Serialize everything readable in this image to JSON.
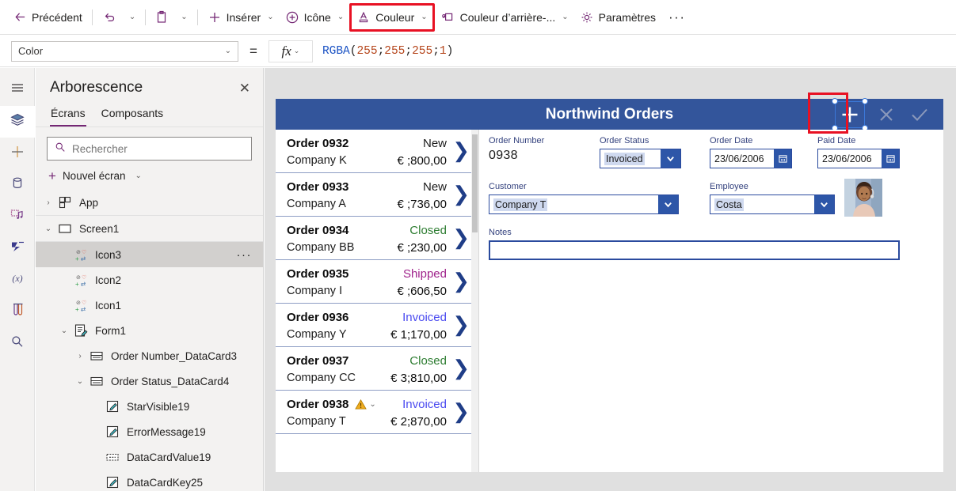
{
  "commandbar": {
    "back_label": "Précédent",
    "undo_icon": "undo-icon",
    "undo_caret": "⌄",
    "paste_icon": "clipboard-icon",
    "paste_caret": "⌄",
    "insert_label": "Insérer",
    "icon_label": "Icône",
    "color_label": "Couleur",
    "background_color_label": "Couleur d’arrière-...",
    "settings_label": "Paramètres",
    "overflow_label": "···",
    "caret": "⌄",
    "highlight_color": "#e81123",
    "accent_color": "#742774"
  },
  "formulabar": {
    "property": "Color",
    "property_caret": "⌄",
    "equals": "=",
    "fx_label": "fx",
    "fx_caret": "⌄",
    "formula_tokens": [
      {
        "text": "RGBA",
        "type": "fn"
      },
      {
        "text": "(",
        "type": "pun"
      },
      {
        "text": "255",
        "type": "num"
      },
      {
        "text": "; ",
        "type": "pun"
      },
      {
        "text": "255",
        "type": "num"
      },
      {
        "text": "; ",
        "type": "pun"
      },
      {
        "text": "255",
        "type": "num"
      },
      {
        "text": "; ",
        "type": "pun"
      },
      {
        "text": "1",
        "type": "num"
      },
      {
        "text": ")",
        "type": "pun"
      }
    ]
  },
  "rail": {
    "items": [
      {
        "icon": "hamburger-menu-icon",
        "active": false
      },
      {
        "icon": "tree-view-layers-icon",
        "active": true
      },
      {
        "icon": "insert-plus-icon",
        "active": false
      },
      {
        "icon": "data-cylinder-icon",
        "active": false
      },
      {
        "icon": "media-icon",
        "active": false
      },
      {
        "icon": "power-automate-flows-icon",
        "active": false
      },
      {
        "icon": "variables-x-icon",
        "active": false
      },
      {
        "icon": "test-tubes-icon",
        "active": false
      },
      {
        "icon": "search-icon",
        "active": false
      }
    ]
  },
  "treepanel": {
    "title": "Arborescence",
    "close_icon": "close-icon",
    "tabs": [
      {
        "label": "Écrans",
        "selected": true
      },
      {
        "label": "Composants",
        "selected": false
      }
    ],
    "search_placeholder": "Rechercher",
    "search_value": "",
    "search_icon": "search-icon",
    "new_screen_label": "Nouvel écran",
    "new_screen_caret": "⌄",
    "nodes": [
      {
        "label": "App",
        "icon": "app-grid-icon",
        "chevron": "›",
        "indent": 0,
        "selected": false,
        "more": false
      },
      {
        "label": "Screen1",
        "icon": "screen-rectangle-icon",
        "chevron": "⌄",
        "indent": 0,
        "selected": false,
        "more": false
      },
      {
        "label": "Icon3",
        "icon": "icon-control-icon",
        "chevron": "",
        "indent": 1,
        "selected": true,
        "more": true
      },
      {
        "label": "Icon2",
        "icon": "icon-control-icon",
        "chevron": "",
        "indent": 1,
        "selected": false,
        "more": false
      },
      {
        "label": "Icon1",
        "icon": "icon-control-icon",
        "chevron": "",
        "indent": 1,
        "selected": false,
        "more": false
      },
      {
        "label": "Form1",
        "icon": "form-edit-icon",
        "chevron": "⌄",
        "indent": 1,
        "selected": false,
        "more": false
      },
      {
        "label": "Order Number_DataCard3",
        "icon": "datacard-icon",
        "chevron": "›",
        "indent": 2,
        "selected": false,
        "more": false
      },
      {
        "label": "Order Status_DataCard4",
        "icon": "datacard-icon",
        "chevron": "⌄",
        "indent": 2,
        "selected": false,
        "more": false
      },
      {
        "label": "StarVisible19",
        "icon": "label-pencil-icon",
        "chevron": "",
        "indent": 3,
        "selected": false,
        "more": false
      },
      {
        "label": "ErrorMessage19",
        "icon": "label-pencil-icon",
        "chevron": "",
        "indent": 3,
        "selected": false,
        "more": false
      },
      {
        "label": "DataCardValue19",
        "icon": "dropdown-control-icon",
        "chevron": "",
        "indent": 3,
        "selected": false,
        "more": false
      },
      {
        "label": "DataCardKey25",
        "icon": "label-pencil-icon",
        "chevron": "",
        "indent": 3,
        "selected": false,
        "more": false
      }
    ]
  },
  "app": {
    "header": {
      "title": "Northwind Orders",
      "bg_color": "#33559b",
      "icons": [
        {
          "name": "add-new-icon",
          "glyph": "+",
          "selected": true
        },
        {
          "name": "cancel-x-icon",
          "glyph": "✕",
          "selected": false
        },
        {
          "name": "confirm-check-icon",
          "glyph": "✓",
          "selected": false
        }
      ]
    },
    "gallery": {
      "rows": [
        {
          "order": "Order 0938",
          "company": "Company T",
          "status": "Invoiced",
          "status_color": "#4a4af0",
          "amount": "€ 2;870,00",
          "warning": true
        },
        {
          "order": "Order 0937",
          "company": "Company CC",
          "status": "Closed",
          "status_color": "#2e7d32",
          "amount": "€ 3;810,00",
          "warning": false
        },
        {
          "order": "Order 0936",
          "company": "Company Y",
          "status": "Invoiced",
          "status_color": "#4a4af0",
          "amount": "€ 1;170,00",
          "warning": false
        },
        {
          "order": "Order 0935",
          "company": "Company I",
          "status": "Shipped",
          "status_color": "#a0248c",
          "amount": "€ ;606,50",
          "warning": false
        },
        {
          "order": "Order 0934",
          "company": "Company BB",
          "status": "Closed",
          "status_color": "#2e7d32",
          "amount": "€ ;230,00",
          "warning": false
        },
        {
          "order": "Order 0933",
          "company": "Company A",
          "status": "New",
          "status_color": "#1b1b1b",
          "amount": "€ ;736,00",
          "warning": false
        },
        {
          "order": "Order 0932",
          "company": "Company K",
          "status": "New",
          "status_color": "#1b1b1b",
          "amount": "€ ;800,00",
          "warning": false
        }
      ],
      "chevron": "❯",
      "warning_icon": "warning-triangle-icon"
    },
    "form": {
      "order_number": {
        "label": "Order Number",
        "value": "0938"
      },
      "order_status": {
        "label": "Order Status",
        "value": "Invoiced"
      },
      "order_date": {
        "label": "Order Date",
        "value": "23/06/2006",
        "icon": "calendar-icon"
      },
      "paid_date": {
        "label": "Paid Date",
        "value": "23/06/2006",
        "icon": "calendar-icon"
      },
      "customer": {
        "label": "Customer",
        "value": "Company T"
      },
      "employee": {
        "label": "Employee",
        "value": "Costa"
      },
      "notes": {
        "label": "Notes",
        "value": ""
      },
      "avatar": {
        "name": "employee-photo"
      },
      "dropdown_caret": "⌄"
    }
  }
}
